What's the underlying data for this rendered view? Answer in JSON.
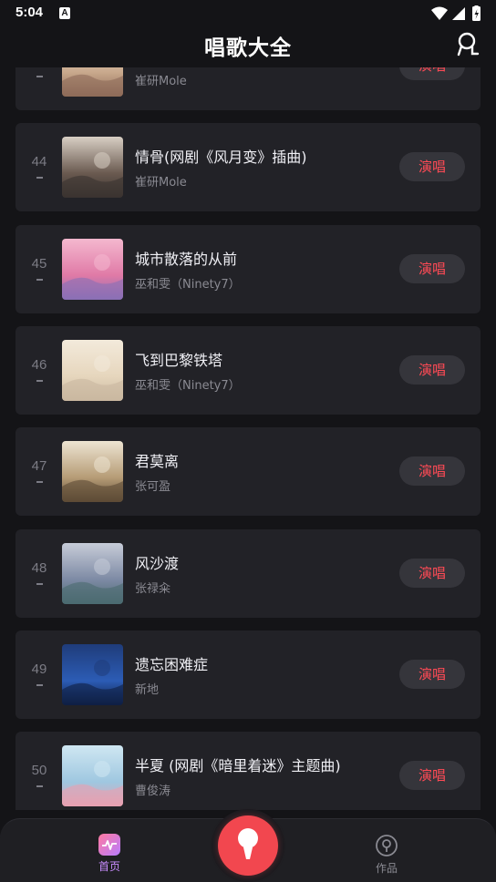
{
  "status": {
    "time": "5:04",
    "notif_letter": "A"
  },
  "header": {
    "title": "唱歌大全",
    "mic_icon": "karaoke-mic-icon"
  },
  "songs": [
    {
      "rank": "",
      "title": "",
      "artist": "崔研Mole",
      "button": "演唱",
      "cover": [
        "#e9dccb",
        "#c9a98d",
        "#8e6a58"
      ]
    },
    {
      "rank": "44",
      "title": "情骨(网剧《风月变》插曲)",
      "artist": "崔研Mole",
      "button": "演唱",
      "cover": [
        "#d8cfc4",
        "#6a5a50",
        "#3a3330"
      ]
    },
    {
      "rank": "45",
      "title": "城市散落的从前",
      "artist": "巫和雯（Ninety7）",
      "button": "演唱",
      "cover": [
        "#f4b8cf",
        "#e07aa6",
        "#8a6fb5"
      ]
    },
    {
      "rank": "46",
      "title": "飞到巴黎铁塔",
      "artist": "巫和雯（Ninety7）",
      "button": "演唱",
      "cover": [
        "#f3eadb",
        "#e6d6bd",
        "#c9b8a0"
      ]
    },
    {
      "rank": "47",
      "title": "君莫离",
      "artist": "张可盈",
      "button": "演唱",
      "cover": [
        "#ede4d2",
        "#b69c76",
        "#5d4b36"
      ]
    },
    {
      "rank": "48",
      "title": "风沙渡",
      "artist": "张禄籴",
      "button": "演唱",
      "cover": [
        "#c7ccd8",
        "#7d8aa4",
        "#4b6a70"
      ]
    },
    {
      "rank": "49",
      "title": "遗忘困难症",
      "artist": "新地",
      "button": "演唱",
      "cover": [
        "#1f3c7a",
        "#2c5cb5",
        "#0f1f44"
      ]
    },
    {
      "rank": "50",
      "title": "半夏 (网剧《暗里着迷》主题曲)",
      "artist": "曹俊涛",
      "button": "演唱",
      "cover": [
        "#cfe7f2",
        "#9fc7e0",
        "#e8a0b0"
      ]
    }
  ],
  "nav": {
    "home_label": "首页",
    "works_label": "作品",
    "accent": "#f2474f"
  }
}
